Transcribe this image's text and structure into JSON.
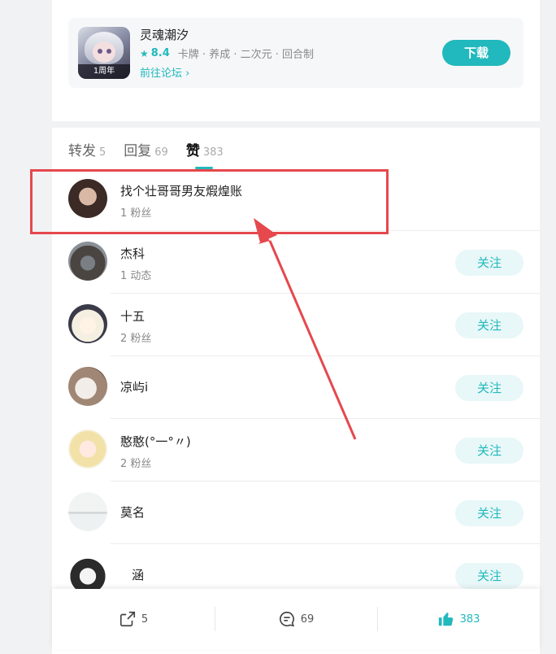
{
  "game": {
    "name": "灵魂潮汐",
    "cover_badge": "1周年",
    "score": "8.4",
    "tags": "卡牌 · 养成 · 二次元 · 回合制",
    "forum_link": "前往论坛 ›",
    "download_label": "下载"
  },
  "tabs": [
    {
      "label": "转发",
      "count": "5",
      "active": false
    },
    {
      "label": "回复",
      "count": "69",
      "active": false
    },
    {
      "label": "赞",
      "count": "383",
      "active": true
    }
  ],
  "users": [
    {
      "name": "找个壮哥哥男友煆煌账",
      "sub": "1 粉丝",
      "follow": ""
    },
    {
      "name": "杰科",
      "sub": "1 动态",
      "follow": "关注"
    },
    {
      "name": "十五",
      "sub": "2 粉丝",
      "follow": "关注"
    },
    {
      "name": "凉屿i",
      "sub": "",
      "follow": "关注"
    },
    {
      "name": "憨憨(°一°〃)",
      "sub": "2 粉丝",
      "follow": "关注"
    },
    {
      "name": "莫名",
      "sub": "",
      "follow": "关注"
    },
    {
      "name": "涵",
      "sub": "",
      "follow": "关注"
    }
  ],
  "bottom_bar": {
    "share_count": "5",
    "comment_count": "69",
    "like_count": "383"
  },
  "colors": {
    "accent": "#21b9bd",
    "highlight": "#e5484d"
  }
}
